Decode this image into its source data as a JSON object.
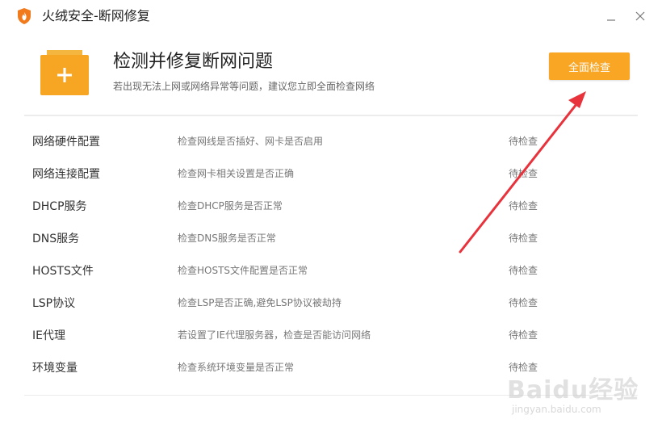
{
  "window": {
    "title": "火绒安全-断网修复",
    "logo_icon": "huorong-shield-icon",
    "minimize_icon": "minimize-icon",
    "close_icon": "close-icon"
  },
  "header": {
    "icon": "folder-plus-icon",
    "title": "检测并修复断网问题",
    "subtitle": "若出现无法上网或网络异常等问题，建议您立即全面检查网络",
    "scan_button": "全面检查",
    "accent_color": "#f8a624"
  },
  "checks": [
    {
      "name": "网络硬件配置",
      "desc": "检查网线是否插好、网卡是否启用",
      "status": "待检查"
    },
    {
      "name": "网络连接配置",
      "desc": "检查网卡相关设置是否正确",
      "status": "待检查"
    },
    {
      "name": "DHCP服务",
      "desc": "检查DHCP服务是否正常",
      "status": "待检查"
    },
    {
      "name": "DNS服务",
      "desc": "检查DNS服务是否正常",
      "status": "待检查"
    },
    {
      "name": "HOSTS文件",
      "desc": "检查HOSTS文件配置是否正常",
      "status": "待检查"
    },
    {
      "name": "LSP协议",
      "desc": "检查LSP是否正确,避免LSP协议被劫持",
      "status": "待检查"
    },
    {
      "name": "IE代理",
      "desc": "若设置了IE代理服务器，检查是否能访问网络",
      "status": "待检查"
    },
    {
      "name": "环境变量",
      "desc": "检查系统环境变量是否正常",
      "status": "待检查"
    }
  ],
  "annotation": {
    "arrow_color": "#e8323c"
  },
  "watermark": {
    "brand": "Baidu经验",
    "url": "jingyan.baidu.com"
  }
}
